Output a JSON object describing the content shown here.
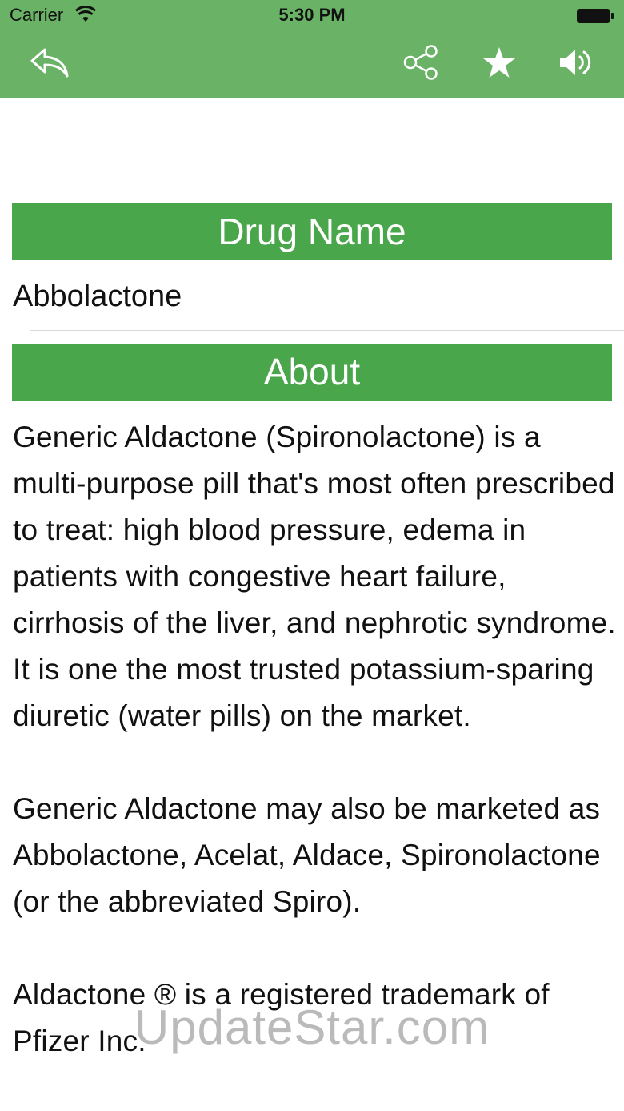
{
  "status_bar": {
    "carrier": "Carrier",
    "time": "5:30 PM"
  },
  "nav": {
    "back_icon": "reply-back-icon",
    "share_icon": "share-icon",
    "favorite_icon": "star-icon",
    "sound_icon": "speaker-icon"
  },
  "colors": {
    "nav_green": "#6ab366",
    "header_green": "#4aa64b"
  },
  "sections": {
    "drug_name_header": "Drug Name",
    "drug_name_value": "Abbolactone",
    "about_header": "About",
    "about_paragraphs": [
      "Generic Aldactone (Spironolactone) is a multi-purpose pill that's most often prescribed to treat: high blood pressure, edema in patients with congestive heart failure, cirrhosis of the liver, and nephrotic syndrome. It is one the most trusted potassium-sparing diuretic (water pills) on the market.",
      "Generic Aldactone may also be marketed as Abbolactone, Acelat, Aldace, Spironolactone (or the abbreviated Spiro).",
      "Aldactone ® is a registered trademark of Pfizer Inc."
    ]
  },
  "watermark": "UpdateStar.com"
}
